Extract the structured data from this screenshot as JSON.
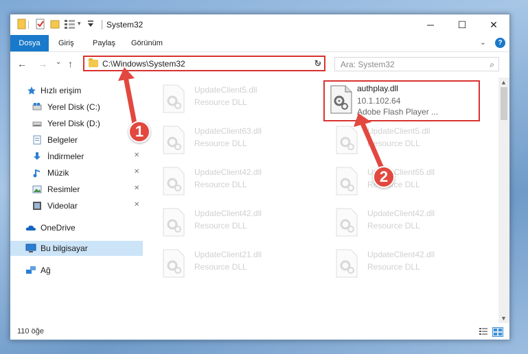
{
  "window": {
    "title": "System32",
    "controls": {
      "minimize": "─",
      "maximize": "☐",
      "close": "✕"
    },
    "quick_access": {
      "more": "▾"
    }
  },
  "ribbon": {
    "tabs": [
      "Dosya",
      "Giriş",
      "Paylaş",
      "Görünüm"
    ],
    "collapse": "⌄",
    "help": "?"
  },
  "nav": {
    "back": "←",
    "forward": "→",
    "recent": "⌄",
    "up": "↑",
    "address": "C:\\Windows\\System32",
    "address_dropdown": "⌄",
    "refresh": "↻",
    "search_placeholder": "Ara: System32",
    "search_icon": "⌕"
  },
  "sidebar": {
    "items": [
      {
        "label": "Hızlı erişim",
        "icon": "star-icon",
        "pinned": false
      },
      {
        "label": "Yerel Disk (C:)",
        "icon": "drive-icon",
        "pinned": false
      },
      {
        "label": "Yerel Disk (D:)",
        "icon": "drive-icon",
        "pinned": false
      },
      {
        "label": "Belgeler",
        "icon": "documents-icon",
        "pinned": false
      },
      {
        "label": "İndirmeler",
        "icon": "download-icon",
        "pinned": true
      },
      {
        "label": "Müzik",
        "icon": "music-icon",
        "pinned": true
      },
      {
        "label": "Resimler",
        "icon": "pictures-icon",
        "pinned": true
      },
      {
        "label": "Videolar",
        "icon": "videos-icon",
        "pinned": true
      },
      {
        "label": "OneDrive",
        "icon": "cloud-icon",
        "pinned": false
      },
      {
        "label": "Bu bilgisayar",
        "icon": "computer-icon",
        "pinned": false
      },
      {
        "label": "Ağ",
        "icon": "network-icon",
        "pinned": false
      }
    ],
    "pin_glyph": "📌"
  },
  "files": {
    "left": [
      {
        "name": "UpdateClient5.dll",
        "type": "Resource DLL"
      },
      {
        "name": "UpdateClient63.dll",
        "type": "Resource DLL"
      },
      {
        "name": "UpdateClient42.dll",
        "type": "Resource DLL"
      },
      {
        "name": "UpdateClient42.dll",
        "type": "Resource DLL"
      },
      {
        "name": "UpdateClient21.dll",
        "type": "Resource DLL"
      }
    ],
    "right": [
      {
        "name": "authplay.dll",
        "version": "10.1.102.64",
        "type": "Adobe Flash Player ..."
      },
      {
        "name": "UpdateClient5.dll",
        "type": "Resource DLL"
      },
      {
        "name": "UpdateClient65.dll",
        "type": "Resource DLL"
      },
      {
        "name": "UpdateClient42.dll",
        "type": "Resource DLL"
      },
      {
        "name": "UpdateClient42.dll",
        "type": "Resource DLL"
      }
    ]
  },
  "status": {
    "count": "110 öğe"
  },
  "annotations": {
    "step1": "1",
    "step2": "2",
    "color": "#e2483f"
  }
}
